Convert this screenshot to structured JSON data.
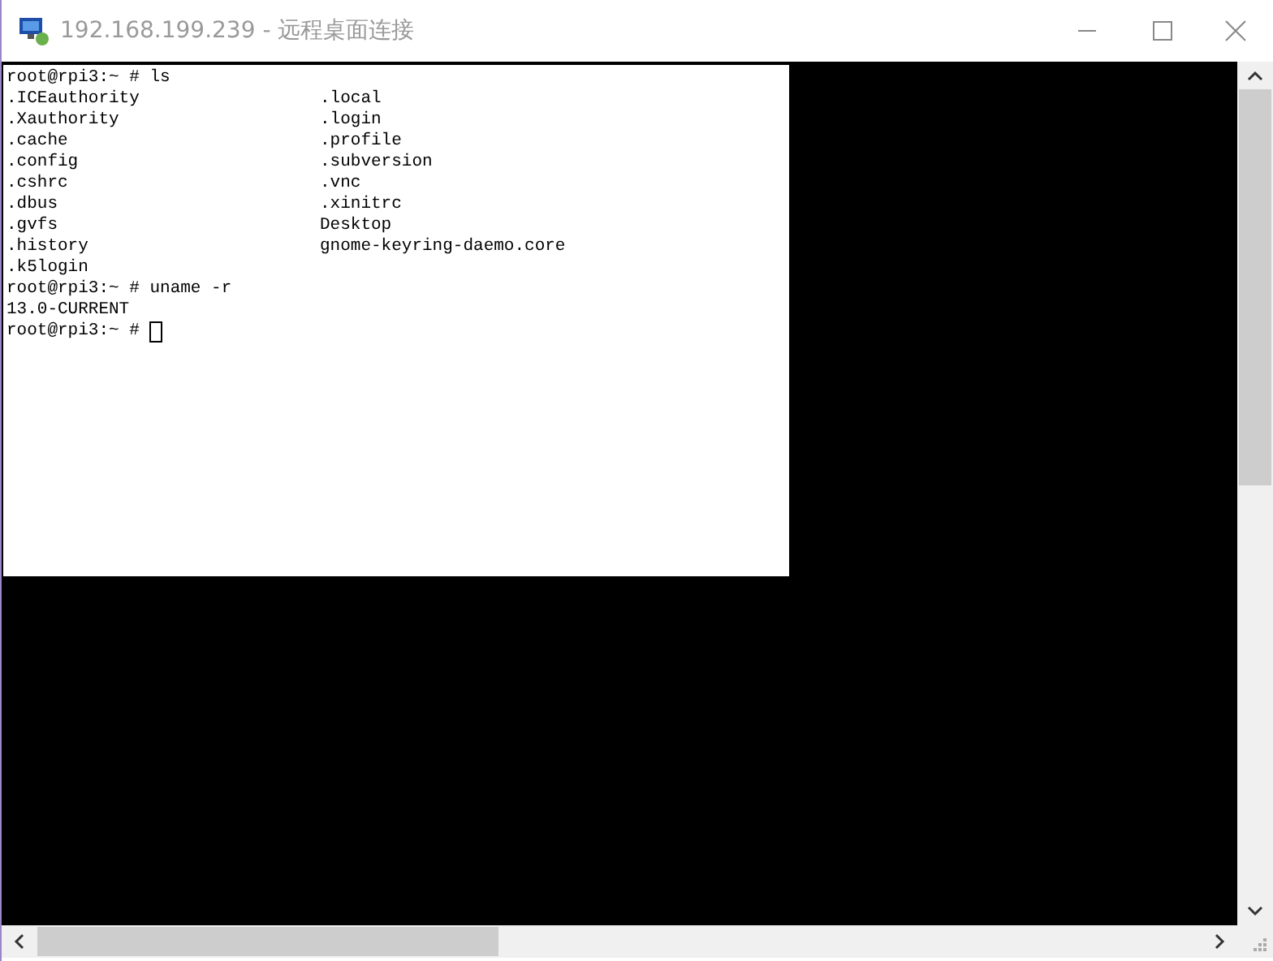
{
  "window": {
    "title": "192.168.199.239 - 远程桌面连接"
  },
  "terminal": {
    "lines": [
      {
        "kind": "text",
        "text": "root@rpi3:~ # ls"
      },
      {
        "kind": "columns",
        "cells": [
          ".ICEauthority",
          ".local"
        ]
      },
      {
        "kind": "columns",
        "cells": [
          ".Xauthority",
          ".login"
        ]
      },
      {
        "kind": "columns",
        "cells": [
          ".cache",
          ".profile"
        ]
      },
      {
        "kind": "columns",
        "cells": [
          ".config",
          ".subversion"
        ]
      },
      {
        "kind": "columns",
        "cells": [
          ".cshrc",
          ".vnc"
        ]
      },
      {
        "kind": "columns",
        "cells": [
          ".dbus",
          ".xinitrc"
        ]
      },
      {
        "kind": "columns",
        "cells": [
          ".gvfs",
          "Desktop"
        ]
      },
      {
        "kind": "columns",
        "cells": [
          ".history",
          "gnome-keyring-daemo.core"
        ]
      },
      {
        "kind": "columns",
        "cells": [
          ".k5login"
        ]
      },
      {
        "kind": "text",
        "text": "root@rpi3:~ # uname -r"
      },
      {
        "kind": "text",
        "text": "13.0-CURRENT"
      },
      {
        "kind": "prompt",
        "text": "root@rpi3:~ #"
      }
    ]
  }
}
